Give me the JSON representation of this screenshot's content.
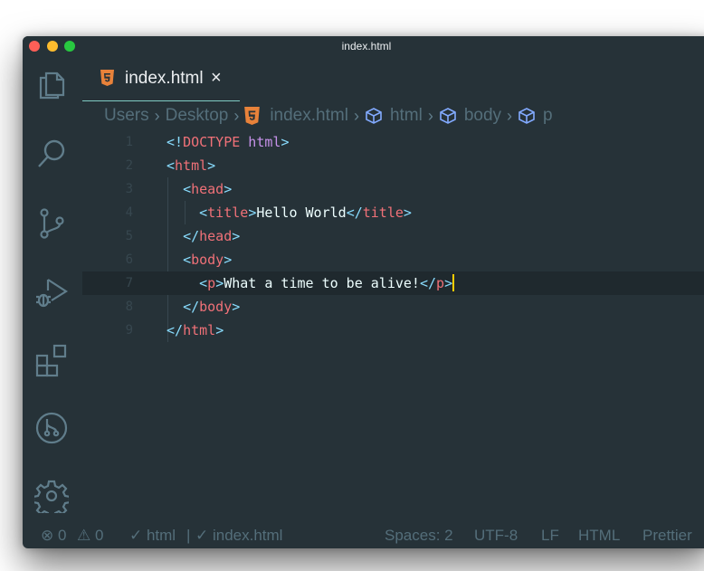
{
  "window": {
    "title": "index.html"
  },
  "tab": {
    "label": "index.html",
    "close": "×"
  },
  "breadcrumb": [
    "Users",
    "Desktop",
    "index.html",
    "html",
    "body",
    "p"
  ],
  "editor": {
    "line_numbers": [
      "1",
      "2",
      "3",
      "4",
      "5",
      "6",
      "7",
      "8",
      "9"
    ],
    "lines": [
      [
        [
          "<!",
          "punct"
        ],
        [
          "DOCTYPE",
          "tag"
        ],
        [
          " html",
          "kw"
        ],
        [
          ">",
          "punct"
        ]
      ],
      [
        [
          "<",
          "punct"
        ],
        [
          "html",
          "tag"
        ],
        [
          ">",
          "punct"
        ]
      ],
      [
        [
          "  ",
          "text"
        ],
        [
          "<",
          "punct"
        ],
        [
          "head",
          "tag"
        ],
        [
          ">",
          "punct"
        ]
      ],
      [
        [
          "    ",
          "text"
        ],
        [
          "<",
          "punct"
        ],
        [
          "title",
          "tag"
        ],
        [
          ">",
          "punct"
        ],
        [
          "Hello World",
          "text"
        ],
        [
          "</",
          "punct"
        ],
        [
          "title",
          "tag"
        ],
        [
          ">",
          "punct"
        ]
      ],
      [
        [
          "  ",
          "text"
        ],
        [
          "</",
          "punct"
        ],
        [
          "head",
          "tag"
        ],
        [
          ">",
          "punct"
        ]
      ],
      [
        [
          "  ",
          "text"
        ],
        [
          "<",
          "punct"
        ],
        [
          "body",
          "tag"
        ],
        [
          ">",
          "punct"
        ]
      ],
      [
        [
          "    ",
          "text"
        ],
        [
          "<",
          "punct"
        ],
        [
          "p",
          "tag"
        ],
        [
          ">",
          "punct"
        ],
        [
          "What a time to be alive!",
          "text"
        ],
        [
          "</",
          "punct"
        ],
        [
          "p",
          "tag"
        ],
        [
          ">",
          "punct"
        ]
      ],
      [
        [
          "  ",
          "text"
        ],
        [
          "</",
          "punct"
        ],
        [
          "body",
          "tag"
        ],
        [
          ">",
          "punct"
        ]
      ],
      [
        [
          "</",
          "punct"
        ],
        [
          "html",
          "tag"
        ],
        [
          ">",
          "punct"
        ]
      ]
    ],
    "active_line": 7
  },
  "statusbar": {
    "errors": "⊗ 0",
    "warnings": "⚠ 0",
    "check_html": "✓ html",
    "divider": "|",
    "check_file": "✓ index.html",
    "spaces": "Spaces: 2",
    "encoding": "UTF-8",
    "eol": "LF",
    "language": "HTML",
    "formatter": "Prettier"
  },
  "colors": {
    "background": "#263238",
    "tag": "#f07178",
    "punct": "#89ddff",
    "keyword": "#c792ea",
    "text": "#eeffff",
    "accent": "#80cbc4",
    "html5": "#e8823a",
    "cursor": "#ffcc00"
  },
  "icons": {
    "activity": [
      "files-icon",
      "search-icon",
      "source-control-icon",
      "run-debug-icon",
      "extensions-icon",
      "git-graph-icon",
      "settings-gear-icon"
    ]
  }
}
